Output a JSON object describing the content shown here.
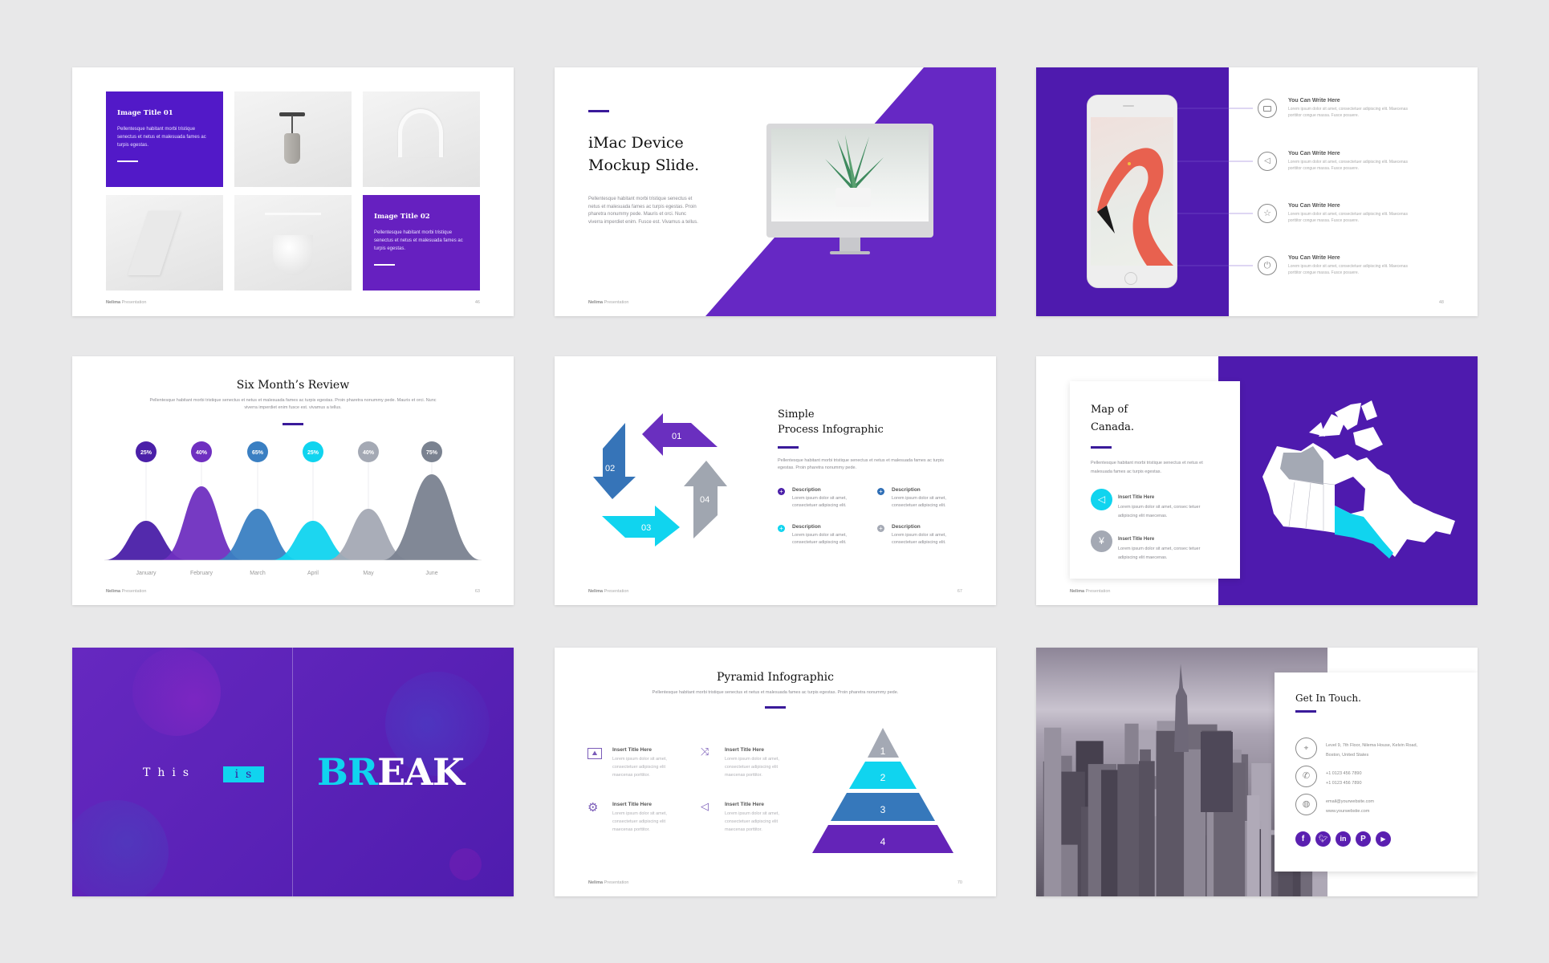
{
  "footer": {
    "brand": "Nelima",
    "label": "Presentation"
  },
  "colors": {
    "purple": "#5219c8",
    "violet": "#6f2fc0",
    "blue": "#3a7fc2",
    "cyan": "#10d4ef",
    "gray": "#a4a9b4",
    "slate": "#7a8290"
  },
  "gallery": {
    "page": "46",
    "boxes": [
      {
        "title": "Image Title 01",
        "text": "Pellentesque habitant morbi tristique senectus et netus et malesuada fames ac turpis egestas."
      },
      {
        "title": "Image Title 02",
        "text": "Pellentesque habitant morbi tristique senectus et netus et malesuada fames ac turpis egestas."
      }
    ]
  },
  "imac": {
    "title1": "iMac Device",
    "title2": "Mockup Slide.",
    "text": "Pellentesque habitant morbi tristique senectus et netus et malesuada fames ac turpis egestas. Proin pharetra nonummy pede. Mauris et orci. Nunc viverra imperdiet enim. Fusce est. Vivamus a tellus."
  },
  "phone": {
    "page": "48",
    "items": [
      {
        "icon": "camera-icon",
        "title": "You Can Write Here",
        "text": "Lorem ipsum dolor sit amet, consectetuer adipiscing elit. Maecenas porttitor congue massa. Fusce posuere."
      },
      {
        "icon": "speaker-icon",
        "title": "You Can Write Here",
        "text": "Lorem ipsum dolor sit amet, consectetuer adipiscing elit. Maecenas porttitor congue massa. Fusce posuere."
      },
      {
        "icon": "star-icon",
        "title": "You Can Write Here",
        "text": "Lorem ipsum dolor sit amet, consectetuer adipiscing elit. Maecenas porttitor congue massa. Fusce posuere."
      },
      {
        "icon": "power-icon",
        "title": "You Can Write Here",
        "text": "Lorem ipsum dolor sit amet, consectetuer adipiscing elit. Maecenas porttitor congue massa. Fusce posuere."
      }
    ]
  },
  "review": {
    "title": "Six Month’s Review",
    "page": "63",
    "text": "Pellentesque habitant morbi tristique senectus et netus et malesuada fames ac turpis egestas. Proin pharetra nonummy pede. Mauris et orci. Nunc viverra imperdiet enim fusce est. vivamus a tellus.",
    "chart_data": {
      "type": "area",
      "categories": [
        "January",
        "February",
        "March",
        "April",
        "May",
        "June"
      ],
      "values": [
        25,
        40,
        65,
        25,
        40,
        75
      ],
      "labels": [
        "25%",
        "40%",
        "65%",
        "25%",
        "40%",
        "75%"
      ],
      "colors": [
        "#4a1fa8",
        "#6f2fc0",
        "#3a7fc2",
        "#10d4ef",
        "#a4a9b4",
        "#7a8290"
      ]
    }
  },
  "process": {
    "title1": "Simple",
    "title2": "Process Infographic",
    "page": "67",
    "text": "Pellentesque habitant morbi tristique senectus et netus et malesuada fames ac turpis egestas. Proin pharetra nonummy pede.",
    "arrows": [
      "01",
      "02",
      "03",
      "04"
    ],
    "items": [
      {
        "title": "Description",
        "text": "Lorem ipsum dolor sit amet, consectetuer adipiscing elit.",
        "color": "#4a1fa8"
      },
      {
        "title": "Description",
        "text": "Lorem ipsum dolor sit amet, consectetuer adipiscing elit.",
        "color": "#2d6db5"
      },
      {
        "title": "Description",
        "text": "Lorem ipsum dolor sit amet, consectetuer adipiscing elit.",
        "color": "#10d4ef"
      },
      {
        "title": "Description",
        "text": "Lorem ipsum dolor sit amet, consectetuer adipiscing elit.",
        "color": "#a4a9b4"
      }
    ]
  },
  "canada": {
    "title1": "Map of",
    "title2": "Canada.",
    "text": "Pellentesque habitant morbi tristique senectus et netus et malesuada fames ac turpis egestas.",
    "items": [
      {
        "icon": "megaphone-icon",
        "title": "Insert Title Here",
        "text": "Lorem ipsum dolor sit amet, consec tetuer adipiscing elit maecenas."
      },
      {
        "icon": "yen-coin-icon",
        "title": "Insert Title Here",
        "text": "Lorem ipsum dolor sit amet, consec tetuer adipiscing elit maecenas."
      }
    ]
  },
  "brk": {
    "this": "This",
    "is": "is",
    "br": "BR",
    "eak": "EAK"
  },
  "pyramid": {
    "title": "Pyramid Infographic",
    "page": "70",
    "text": "Pellentesque habitant morbi tristique senectus et netus et malesuada fames ac turpis egestas. Proin pharetra nonummy pede.",
    "levels": [
      "1",
      "2",
      "3",
      "4"
    ],
    "items": [
      {
        "icon": "image-icon",
        "title": "Insert Title Here",
        "text": "Lorem ipsum dolor sit amet, consectetuer adipiscing elit maecenas porttitor."
      },
      {
        "icon": "shuffle-icon",
        "title": "Insert Title Here",
        "text": "Lorem ipsum dolor sit amet, consectetuer adipiscing elit maecenas porttitor."
      },
      {
        "icon": "gear-icon",
        "title": "Insert Title Here",
        "text": "Lorem ipsum dolor sit amet, consectetuer adipiscing elit maecenas porttitor."
      },
      {
        "icon": "megaphone-icon",
        "title": "Insert Title Here",
        "text": "Lorem ipsum dolor sit amet, consectetuer adipiscing elit maecenas porttitor."
      }
    ]
  },
  "contact": {
    "title": "Get In Touch.",
    "address1": "Level 9, 7th Floor, Nilema House, Kelvin Road,",
    "address2": "Boston, United States",
    "phone1": "+1 0123 456 7890",
    "phone2": "+1 0123 456 7890",
    "email": "email@yourwebsite.com",
    "web": "www.yourwebstie.com",
    "social": [
      "facebook-icon",
      "twitter-icon",
      "linkedin-icon",
      "pinterest-icon",
      "youtube-icon"
    ]
  }
}
